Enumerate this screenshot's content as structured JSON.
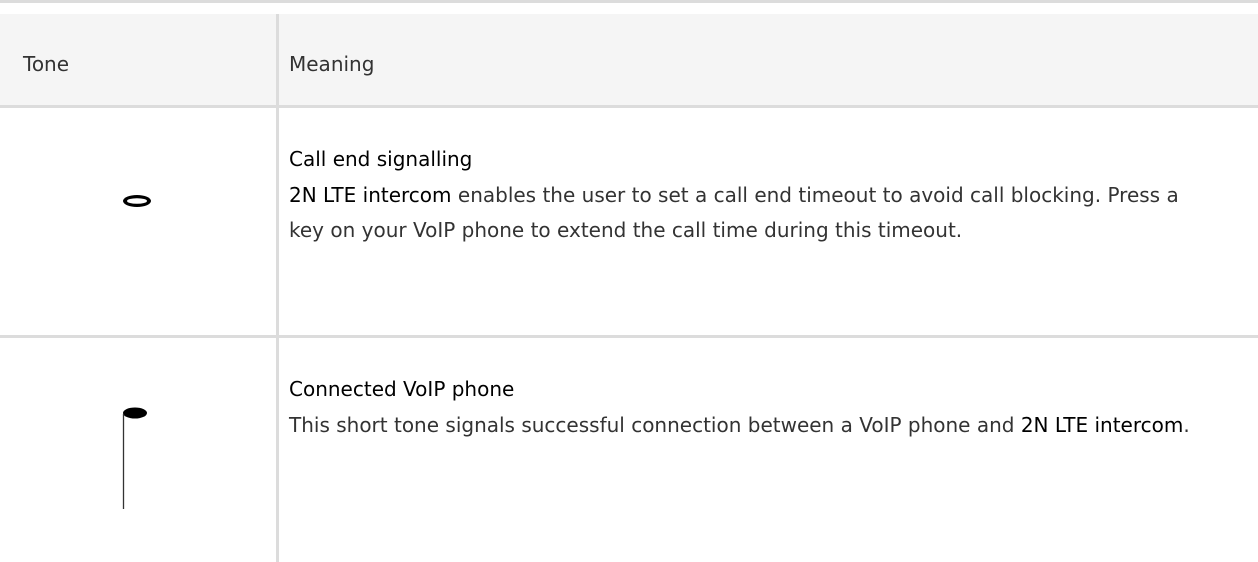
{
  "table": {
    "headers": {
      "tone": "Tone",
      "meaning": "Meaning"
    },
    "rows": [
      {
        "tone_icon": "whole-note-icon",
        "title": "Call end signalling",
        "desc_strong": "2N LTE intercom",
        "desc_rest": " enables the user to set a call end timeout to avoid call blocking. Press a key on your VoIP phone to extend the call time during this timeout."
      },
      {
        "tone_icon": "eighth-note-icon",
        "title": "Connected VoIP phone",
        "desc_before": "This short tone signals successful connection between a VoIP phone and ",
        "desc_strong": "2N LTE intercom",
        "desc_after": "."
      }
    ]
  }
}
